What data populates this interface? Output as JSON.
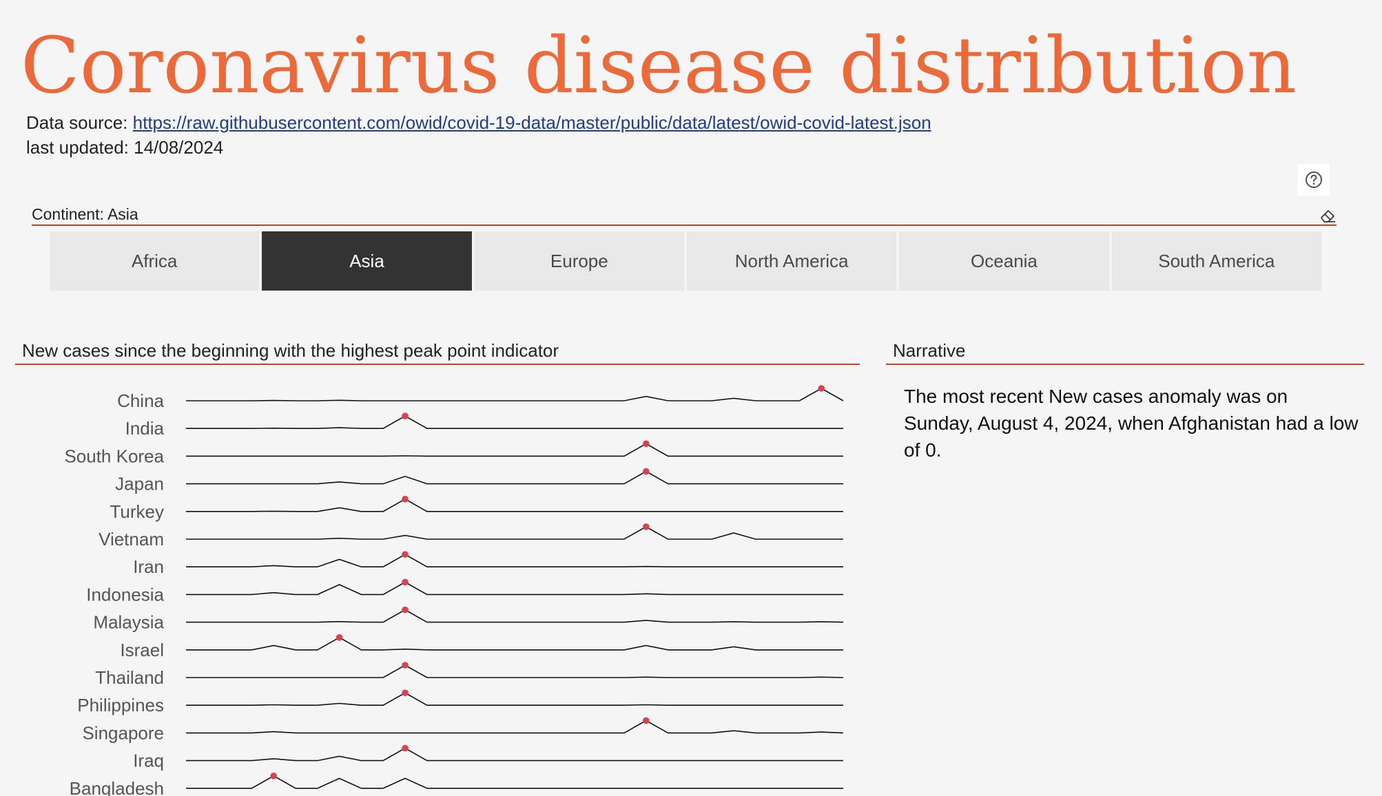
{
  "header": {
    "title": "Coronavirus disease distribution",
    "source_prefix": "Data source: ",
    "source_url": "https://raw.githubusercontent.com/owid/covid-19-data/master/public/data/latest/owid-covid-latest.json",
    "last_updated": "last updated: 14/08/2024"
  },
  "slicer": {
    "label": "Continent: Asia",
    "options": [
      "Africa",
      "Asia",
      "Europe",
      "North America",
      "Oceania",
      "South America"
    ],
    "selected": "Asia"
  },
  "icons": {
    "help": "question-circle-icon",
    "eraser": "eraser-icon"
  },
  "colors": {
    "title": "#ec6a3a",
    "accent_line": "#c0452a",
    "peak_marker": "#d9434e",
    "selected_tile": "#333333"
  },
  "chart_section": {
    "title": "New cases since the beginning with the highest peak point indicator"
  },
  "narrative": {
    "title": "Narrative",
    "text": "The most recent New cases anomaly was on Sunday, August 4, 2024, when Afghanistan had a low of 0."
  },
  "chart_data": {
    "type": "line",
    "countries": [
      "China",
      "India",
      "South Korea",
      "Japan",
      "Turkey",
      "Vietnam",
      "Iran",
      "Indonesia",
      "Malaysia",
      "Israel",
      "Thailand",
      "Philippines",
      "Singapore",
      "Iraq",
      "Bangladesh"
    ],
    "x": [
      0,
      1,
      2,
      3,
      4,
      5,
      6,
      7,
      8,
      9,
      10,
      11,
      12,
      13,
      14,
      15,
      16,
      17,
      18,
      19,
      20,
      21,
      22,
      23,
      24,
      25,
      26,
      27,
      28,
      29,
      30
    ],
    "series": [
      {
        "name": "China",
        "values": [
          0,
          0,
          0,
          0,
          0.02,
          0,
          0,
          0.04,
          0,
          0,
          0,
          0,
          0,
          0,
          0,
          0,
          0,
          0,
          0,
          0,
          0,
          0.35,
          0,
          0,
          0,
          0.2,
          0,
          0,
          0,
          1,
          0
        ]
      },
      {
        "name": "India",
        "values": [
          0,
          0,
          0,
          0,
          0.02,
          0,
          0,
          0.06,
          0,
          0,
          1,
          0,
          0,
          0,
          0,
          0,
          0,
          0,
          0,
          0,
          0,
          0,
          0,
          0,
          0,
          0,
          0,
          0,
          0,
          0,
          0
        ]
      },
      {
        "name": "South Korea",
        "values": [
          0,
          0,
          0,
          0,
          0,
          0,
          0,
          0,
          0,
          0,
          0.02,
          0,
          0,
          0,
          0,
          0,
          0,
          0,
          0,
          0,
          0,
          1,
          0,
          0,
          0,
          0,
          0,
          0,
          0,
          0,
          0
        ]
      },
      {
        "name": "Japan",
        "values": [
          0,
          0,
          0,
          0,
          0,
          0,
          0,
          0.15,
          0,
          0,
          0.6,
          0,
          0,
          0,
          0,
          0,
          0,
          0,
          0,
          0,
          0,
          1,
          0,
          0,
          0,
          0,
          0,
          0,
          0,
          0,
          0
        ]
      },
      {
        "name": "Turkey",
        "values": [
          0,
          0,
          0,
          0,
          0.02,
          0,
          0,
          0.3,
          0,
          0,
          1,
          0,
          0,
          0,
          0,
          0,
          0,
          0,
          0,
          0,
          0,
          0,
          0,
          0,
          0,
          0,
          0,
          0,
          0,
          0,
          0
        ]
      },
      {
        "name": "Vietnam",
        "values": [
          0,
          0,
          0,
          0,
          0,
          0,
          0,
          0.07,
          0,
          0,
          0.3,
          0,
          0,
          0,
          0,
          0,
          0,
          0,
          0,
          0,
          0,
          1,
          0,
          0,
          0,
          0.5,
          0,
          0,
          0,
          0,
          0
        ]
      },
      {
        "name": "Iran",
        "values": [
          0,
          0,
          0,
          0,
          0.1,
          0,
          0,
          0.6,
          0,
          0,
          1,
          0,
          0,
          0,
          0,
          0,
          0,
          0,
          0,
          0,
          0,
          0.03,
          0,
          0,
          0,
          0,
          0,
          0,
          0,
          0,
          0
        ]
      },
      {
        "name": "Indonesia",
        "values": [
          0,
          0,
          0,
          0,
          0.15,
          0,
          0,
          0.8,
          0,
          0,
          1,
          0,
          0,
          0,
          0,
          0,
          0,
          0,
          0,
          0,
          0,
          0.06,
          0,
          0,
          0,
          0,
          0,
          0,
          0,
          0,
          0
        ]
      },
      {
        "name": "Malaysia",
        "values": [
          0,
          0,
          0,
          0,
          0,
          0,
          0,
          0.05,
          0,
          0,
          1,
          0,
          0,
          0,
          0,
          0,
          0,
          0,
          0,
          0,
          0,
          0.15,
          0,
          0,
          0,
          0.04,
          0,
          0,
          0,
          0.04,
          0
        ]
      },
      {
        "name": "Israel",
        "values": [
          0,
          0,
          0,
          0,
          0.35,
          0,
          0,
          1,
          0,
          0,
          0.06,
          0,
          0,
          0,
          0,
          0,
          0,
          0,
          0,
          0,
          0,
          0.35,
          0,
          0,
          0,
          0.25,
          0,
          0,
          0,
          0,
          0
        ]
      },
      {
        "name": "Thailand",
        "values": [
          0,
          0,
          0,
          0,
          0,
          0,
          0,
          0,
          0,
          0,
          1,
          0,
          0,
          0,
          0,
          0,
          0,
          0,
          0,
          0,
          0,
          0.04,
          0,
          0,
          0,
          0,
          0,
          0,
          0,
          0.04,
          0
        ]
      },
      {
        "name": "Philippines",
        "values": [
          0,
          0,
          0,
          0,
          0.04,
          0,
          0,
          0.15,
          0,
          0,
          1,
          0,
          0,
          0,
          0,
          0,
          0,
          0,
          0,
          0,
          0,
          0.04,
          0,
          0,
          0,
          0,
          0,
          0,
          0,
          0,
          0
        ]
      },
      {
        "name": "Singapore",
        "values": [
          0,
          0,
          0,
          0,
          0.1,
          0,
          0,
          0,
          0,
          0,
          0,
          0,
          0,
          0,
          0,
          0,
          0,
          0,
          0,
          0,
          0,
          1,
          0,
          0,
          0,
          0.18,
          0,
          0,
          0,
          0.07,
          0
        ]
      },
      {
        "name": "Iraq",
        "values": [
          0,
          0,
          0,
          0,
          0.15,
          0,
          0,
          0.35,
          0,
          0,
          1,
          0,
          0,
          0,
          0,
          0,
          0,
          0,
          0,
          0,
          0,
          0,
          0,
          0,
          0,
          0,
          0,
          0,
          0,
          0,
          0
        ]
      },
      {
        "name": "Bangladesh",
        "values": [
          0,
          0,
          0,
          0,
          1,
          0,
          0,
          0.8,
          0,
          0,
          0.8,
          0,
          0,
          0,
          0,
          0,
          0,
          0,
          0,
          0,
          0,
          0,
          0,
          0,
          0,
          0,
          0,
          0,
          0,
          0,
          0
        ]
      }
    ],
    "peak_marker": "highest value per country"
  }
}
